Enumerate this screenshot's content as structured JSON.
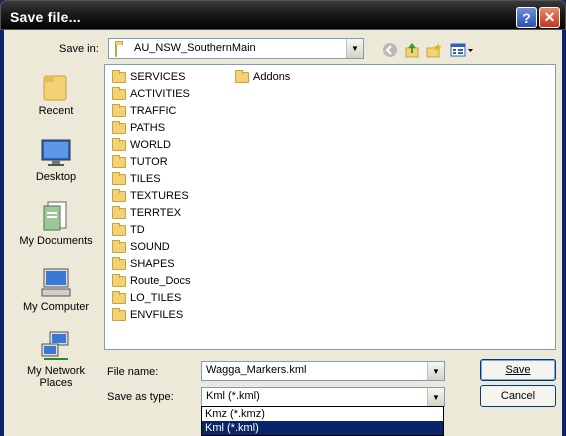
{
  "dialog": {
    "title": "Save file...",
    "help_glyph": "?",
    "close_glyph": "✕"
  },
  "save_in": {
    "label": "Save in:",
    "value": "AU_NSW_SouthernMain"
  },
  "places": [
    {
      "label": "Recent",
      "icon": "recent-folder-icon"
    },
    {
      "label": "Desktop",
      "icon": "desktop-icon"
    },
    {
      "label": "My Documents",
      "icon": "my-documents-icon"
    },
    {
      "label": "My Computer",
      "icon": "my-computer-icon"
    },
    {
      "label": "My Network Places",
      "icon": "network-places-icon"
    }
  ],
  "files_col1": [
    "SERVICES",
    "ACTIVITIES",
    "TRAFFIC",
    "PATHS",
    "WORLD",
    "TUTOR",
    "TILES",
    "TEXTURES",
    "TERRTEX",
    "TD",
    "SOUND",
    "SHAPES",
    "Route_Docs",
    "LO_TILES",
    "ENVFILES"
  ],
  "files_col2": [
    "Addons"
  ],
  "file_name": {
    "label": "File name:",
    "value": "Wagga_Markers.kml"
  },
  "save_type": {
    "label": "Save as type:",
    "value": "Kml (*.kml)",
    "options": [
      "Kmz (*.kmz)",
      "Kml (*.kml)"
    ],
    "selected_index": 1
  },
  "buttons": {
    "save": "Save",
    "cancel": "Cancel"
  },
  "colors": {
    "titlebar": "#1a1a1a",
    "selection": "#0a246a",
    "dialog_bg": "#ece9d8"
  }
}
